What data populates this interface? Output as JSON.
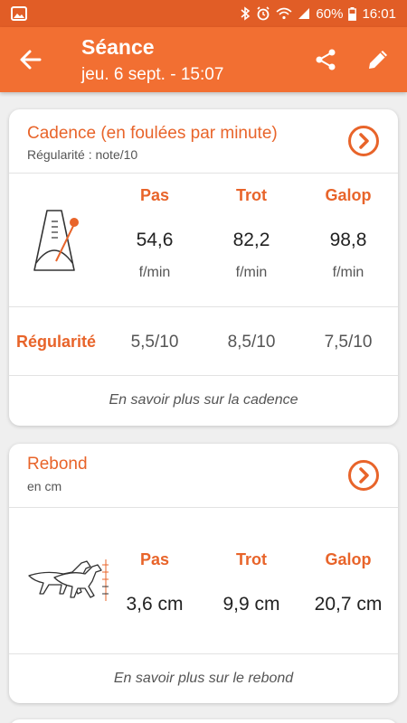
{
  "status": {
    "battery": "60%",
    "time": "16:01"
  },
  "header": {
    "title": "Séance",
    "subtitle": "jeu. 6 sept. - 15:07"
  },
  "cadence": {
    "title": "Cadence (en foulées par minute)",
    "subtitle": "Régularité : note/10",
    "columns": [
      {
        "gait": "Pas",
        "value": "54,6",
        "unit": "f/min",
        "regularity": "5,5/10"
      },
      {
        "gait": "Trot",
        "value": "82,2",
        "unit": "f/min",
        "regularity": "8,5/10"
      },
      {
        "gait": "Galop",
        "value": "98,8",
        "unit": "f/min",
        "regularity": "7,5/10"
      }
    ],
    "regularity_label": "Régularité",
    "more_link": "En savoir plus sur la cadence"
  },
  "rebond": {
    "title": "Rebond",
    "subtitle": "en cm",
    "columns": [
      {
        "gait": "Pas",
        "value": "3,6 cm"
      },
      {
        "gait": "Trot",
        "value": "9,9 cm"
      },
      {
        "gait": "Galop",
        "value": "20,7 cm"
      }
    ],
    "more_link": "En savoir plus sur le rebond"
  },
  "colors": {
    "accent": "#f26f32",
    "status_bar": "#e15d26",
    "orange_text": "#e8642a"
  }
}
